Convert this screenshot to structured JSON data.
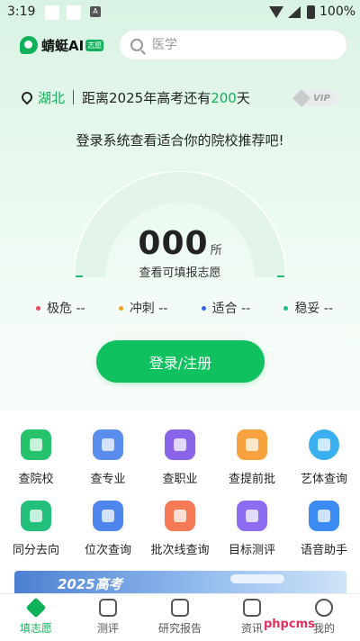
{
  "status_bar": {
    "time": "3:19",
    "notif_icon": "A",
    "battery": "100%"
  },
  "header": {
    "logo_text": "蜻蜓AI",
    "logo_badge": "志愿",
    "search_placeholder": "医学"
  },
  "location": {
    "province": "湖北",
    "countdown_prefix": "距离2025年高考还有",
    "days": "200",
    "countdown_suffix": "天",
    "vip_label": "VIP"
  },
  "promo_text": "登录系统查看适合你的院校推荐吧!",
  "gauge": {
    "count": "000",
    "unit": "所",
    "subtitle": "查看可填报志愿"
  },
  "levels": [
    {
      "label": "极危 --",
      "color": "#e84a5f"
    },
    {
      "label": "冲刺 --",
      "color": "#f5a023"
    },
    {
      "label": "适合 --",
      "color": "#3563e9"
    },
    {
      "label": "稳妥 --",
      "color": "#1bbf8a"
    }
  ],
  "login_button": "登录/注册",
  "tools_row1": [
    {
      "label": "查院校",
      "icon": "school-icon",
      "color": "#27c26c"
    },
    {
      "label": "查专业",
      "icon": "major-icon",
      "color": "#5b8def"
    },
    {
      "label": "查职业",
      "icon": "briefcase-icon",
      "color": "#8a64e8"
    },
    {
      "label": "查提前批",
      "icon": "calendar-icon",
      "color": "#f7a23e"
    },
    {
      "label": "艺体查询",
      "icon": "palette-icon",
      "color": "#3ab0f0"
    }
  ],
  "tools_row2": [
    {
      "label": "同分去向",
      "icon": "direction-icon",
      "color": "#22c07a"
    },
    {
      "label": "位次查询",
      "icon": "rank-icon",
      "color": "#4f86ee"
    },
    {
      "label": "批次线查询",
      "icon": "trend-icon",
      "color": "#f47a55"
    },
    {
      "label": "目标测评",
      "icon": "target-icon",
      "color": "#8c6cf0"
    },
    {
      "label": "语音助手",
      "icon": "microphone-icon",
      "color": "#3c8bf2"
    }
  ],
  "banner_text": "2025高考",
  "bottom_nav": [
    {
      "label": "填志愿",
      "active": true
    },
    {
      "label": "测评",
      "active": false
    },
    {
      "label": "研究报告",
      "active": false
    },
    {
      "label": "资讯",
      "active": false
    },
    {
      "label": "我的",
      "active": false
    }
  ],
  "watermark": "phpcms"
}
